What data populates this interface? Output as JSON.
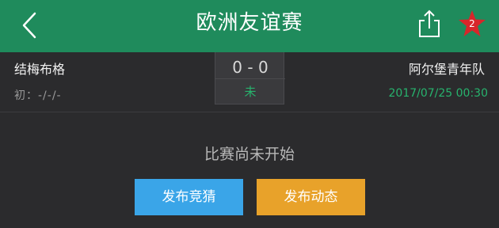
{
  "header": {
    "title": "欧洲友谊赛",
    "back_icon": "chevron-left-icon",
    "share_icon": "share-icon",
    "favorite_icon": "star-icon",
    "favorite_count": "2",
    "bg_color": "#1f8b5c",
    "star_color": "#d8262a"
  },
  "match": {
    "home_team": "结梅布格",
    "away_team": "阿尔堡青年队",
    "score": "0 - 0",
    "status": "未",
    "odds_label": "初：-/-/-",
    "datetime": "2017/07/25 00:30",
    "accent_color": "#27b36d"
  },
  "content": {
    "empty_message": "比赛尚未开始",
    "guess_button": "发布竞猜",
    "post_button": "发布动态",
    "guess_color": "#3aa5e8",
    "post_color": "#e8a22a"
  }
}
